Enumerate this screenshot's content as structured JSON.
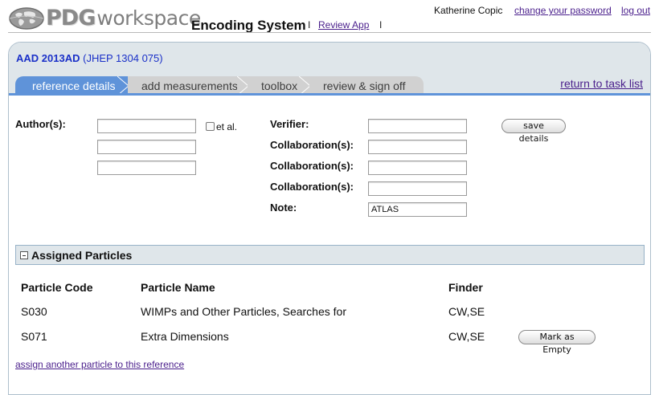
{
  "header": {
    "logo_pdg": "PDG",
    "logo_workspace": "workspace",
    "app_title": "Encoding System",
    "review_app_link": "Review App",
    "user_name": "Katherine Copic",
    "change_password_link": "change your password",
    "logout_link": "log out",
    "separator": "I"
  },
  "reference": {
    "id": "AAD 2013AD",
    "citation": "(JHEP 1304 075)"
  },
  "tabs": [
    {
      "label": "reference details",
      "active": true
    },
    {
      "label": "add measurements",
      "active": false
    },
    {
      "label": "toolbox",
      "active": false
    },
    {
      "label": "review & sign off",
      "active": false
    }
  ],
  "return_link": "return to task list",
  "form": {
    "authors_label": "Author(s):",
    "authors": [
      "",
      "",
      ""
    ],
    "et_al_label": "et al.",
    "verifier_label": "Verifier:",
    "verifier_value": "",
    "collaboration_label": "Collaboration(s):",
    "collaborations": [
      "",
      "",
      ""
    ],
    "note_label": "Note:",
    "note_value": "ATLAS",
    "save_button": "save details"
  },
  "particles": {
    "section_title": "Assigned Particles",
    "columns": [
      "Particle Code",
      "Particle Name",
      "Finder"
    ],
    "rows": [
      {
        "code": "S030",
        "name": "WIMPs and Other Particles, Searches for",
        "finder": "CW,SE",
        "action": ""
      },
      {
        "code": "S071",
        "name": "Extra Dimensions",
        "finder": "CW,SE",
        "action": "Mark as Empty"
      }
    ],
    "assign_link": "assign another particle to this reference"
  },
  "colors": {
    "accent_blue": "#5f93d9",
    "link_purple": "#4a1f8c",
    "reference_blue": "#1a30c8",
    "panel_header_bg": "#dfe6ea",
    "inactive_tab": "#d1d1d1"
  },
  "icons": {
    "logo": "globe-icon",
    "collapse": "minus-square-icon",
    "tab_separator": "chevron-right-icon"
  }
}
